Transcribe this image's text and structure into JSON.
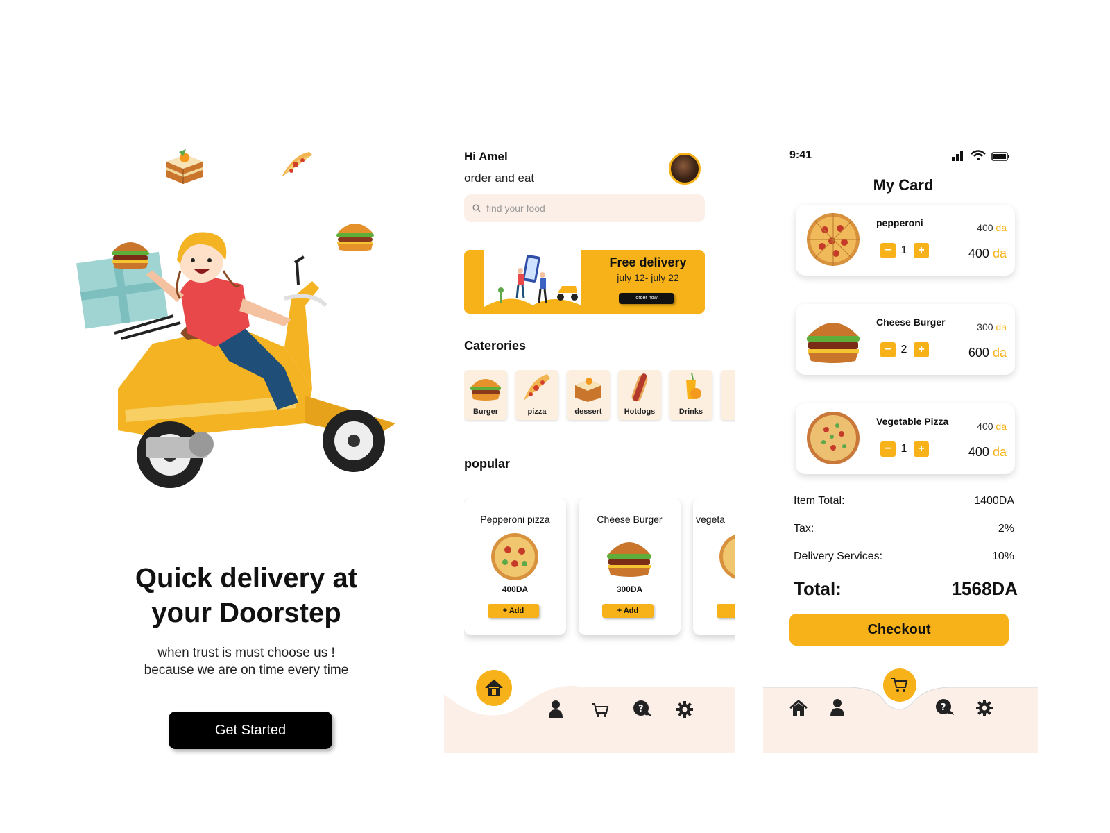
{
  "onboarding": {
    "title_line1": "Quick delivery at",
    "title_line2": "your Doorstep",
    "subtitle_line1": "when trust is must choose us !",
    "subtitle_line2": "because we are on time every time",
    "cta": "Get Started"
  },
  "home": {
    "greeting": "Hi Amel",
    "greeting_sub": "order and eat",
    "search_placeholder": "find your food",
    "promo": {
      "title": "Free delivery",
      "date": "july 12- july 22",
      "button": "order now"
    },
    "categories_title": "Caterories",
    "categories": [
      {
        "label": "Burger",
        "icon": "burger-icon"
      },
      {
        "label": "pizza",
        "icon": "pizza-slice-icon"
      },
      {
        "label": "dessert",
        "icon": "cake-icon"
      },
      {
        "label": "Hotdogs",
        "icon": "hotdog-icon"
      },
      {
        "label": "Drinks",
        "icon": "drink-icon"
      }
    ],
    "popular_title": "popular",
    "popular": [
      {
        "name": "Pepperoni pizza",
        "price": "400DA",
        "add": "+ Add"
      },
      {
        "name": "Cheese Burger",
        "price": "300DA",
        "add": "+ Add"
      },
      {
        "name": "vegeta",
        "price": "",
        "add": ""
      }
    ],
    "nav": [
      "home-icon",
      "user-icon",
      "cart-icon",
      "chat-help-icon",
      "gear-icon"
    ]
  },
  "cart": {
    "status_time": "9:41",
    "title": "My Card",
    "currency": "da",
    "items": [
      {
        "name": "pepperoni",
        "unit_price": "400",
        "qty": "1",
        "total": "400"
      },
      {
        "name": "Cheese Burger",
        "unit_price": "300",
        "qty": "2",
        "total": "600"
      },
      {
        "name": "Vegetable Pizza",
        "unit_price": "400",
        "qty": "1",
        "total": "400"
      }
    ],
    "summary": {
      "item_total_label": "Item Total:",
      "item_total_value": "1400DA",
      "tax_label": "Tax:",
      "tax_value": "2%",
      "delivery_label": "Delivery Services:",
      "delivery_value": "10%",
      "total_label": "Total:",
      "total_value": "1568DA"
    },
    "checkout": "Checkout"
  },
  "colors": {
    "accent": "#f6b218",
    "nav_bg": "#fcefe8",
    "dark": "#000000"
  }
}
